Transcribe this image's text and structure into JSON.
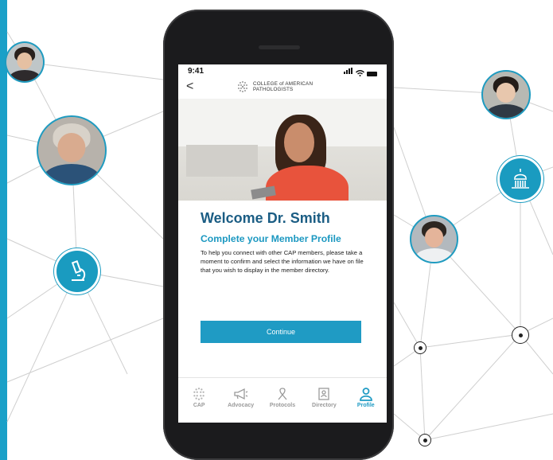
{
  "status_bar": {
    "time": "9:41"
  },
  "app": {
    "back_glyph": "<",
    "logo_line1": "COLLEGE of AMERICAN",
    "logo_line2": "PATHOLOGISTS"
  },
  "profile_prompt": {
    "title": "Welcome Dr. Smith",
    "subtitle": "Complete your Member Profile",
    "description": "To help you connect with other CAP members, please take a moment to confirm and select the information we have on file that you wish to display in the member directory.",
    "button_label": "Continue"
  },
  "tabs": [
    {
      "label": "CAP",
      "icon": "cap-logo-icon",
      "active": false
    },
    {
      "label": "Advocacy",
      "icon": "megaphone-icon",
      "active": false
    },
    {
      "label": "Protocols",
      "icon": "ribbon-icon",
      "active": false
    },
    {
      "label": "Directory",
      "icon": "directory-icon",
      "active": false
    },
    {
      "label": "Profile",
      "icon": "person-icon",
      "active": true
    }
  ],
  "colors": {
    "accent": "#1f9bc4",
    "title": "#1b5d84",
    "left_bar": "#1aa0c8"
  },
  "network_nodes": [
    "microscope-icon",
    "capitol-icon"
  ]
}
